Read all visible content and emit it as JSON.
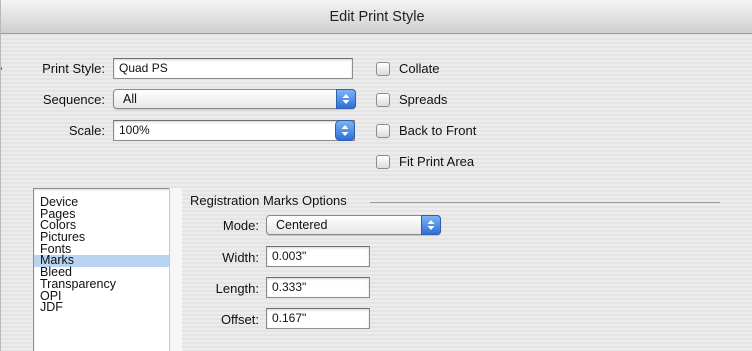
{
  "window": {
    "title": "Edit Print Style"
  },
  "form": {
    "print_style_label": "Print Style:",
    "print_style_value": "Quad PS",
    "sequence_label": "Sequence:",
    "sequence_value": "All",
    "scale_label": "Scale:",
    "scale_value": "100%"
  },
  "options": [
    {
      "label": "Collate",
      "checked": false
    },
    {
      "label": "Spreads",
      "checked": false
    },
    {
      "label": "Back to Front",
      "checked": false
    },
    {
      "label": "Fit Print Area",
      "checked": false
    }
  ],
  "sidebar": {
    "items": [
      {
        "label": "Device"
      },
      {
        "label": "Pages"
      },
      {
        "label": "Colors"
      },
      {
        "label": "Pictures"
      },
      {
        "label": "Fonts"
      },
      {
        "label": "Marks"
      },
      {
        "label": "Bleed"
      },
      {
        "label": "Transparency"
      },
      {
        "label": "OPI"
      },
      {
        "label": "JDF"
      }
    ],
    "selected": "Marks"
  },
  "registration": {
    "group_title": "Registration Marks Options",
    "mode_label": "Mode:",
    "mode_value": "Centered",
    "width_label": "Width:",
    "width_value": "0.003\"",
    "length_label": "Length:",
    "length_value": "0.333\"",
    "offset_label": "Offset:",
    "offset_value": "0.167\""
  },
  "colors": {
    "selection": "#b9d4f2",
    "popup_arrow_blue": "#2e6fd8"
  }
}
